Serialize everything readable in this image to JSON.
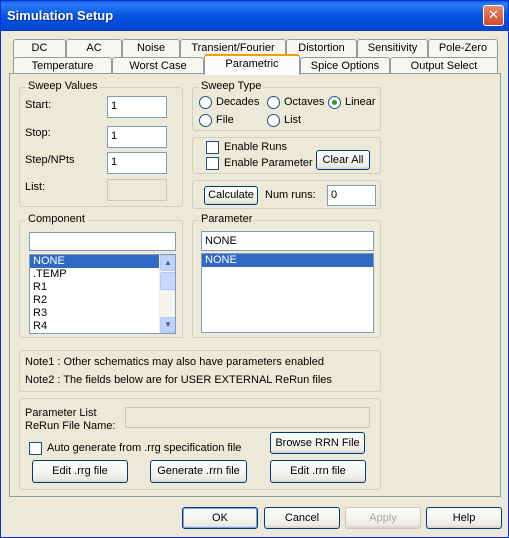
{
  "window": {
    "title": "Simulation Setup",
    "close": "✕"
  },
  "tabs_row1": [
    "DC",
    "AC",
    "Noise",
    "Transient/Fourier",
    "Distortion",
    "Sensitivity",
    "Pole-Zero"
  ],
  "tabs_row2": [
    "Temperature",
    "Worst Case",
    "Parametric",
    "Spice Options",
    "Output Select"
  ],
  "active_tab": "Parametric",
  "sweep_values": {
    "legend": "Sweep Values",
    "start_label": "Start:",
    "start_value": "1",
    "stop_label": "Stop:",
    "stop_value": "1",
    "step_label": "Step/NPts",
    "step_value": "1",
    "list_label": "List:",
    "list_value": ""
  },
  "sweep_type": {
    "legend": "Sweep Type",
    "decades": "Decades",
    "octaves": "Octaves",
    "linear": "Linear",
    "file": "File",
    "list": "List",
    "selected": "Linear"
  },
  "runs": {
    "enable_runs": "Enable Runs",
    "enable_parameter": "Enable Parameter",
    "clear_all": "Clear All"
  },
  "calc": {
    "calculate": "Calculate",
    "num_runs_label": "Num runs:",
    "num_runs_value": "0"
  },
  "component": {
    "legend": "Component",
    "filter_value": "",
    "items": [
      "NONE",
      ".TEMP",
      "R1",
      "R2",
      "R3",
      "R4"
    ],
    "selected": "NONE"
  },
  "parameter": {
    "legend": "Parameter",
    "value": "NONE",
    "items": [
      "NONE"
    ],
    "selected": "NONE"
  },
  "notes": {
    "note1": "Note1 : Other schematics may also have parameters enabled",
    "note2": "Note2 : The fields below are for USER EXTERNAL ReRun files"
  },
  "rerun": {
    "param_list_label": "Parameter List",
    "rerun_file_label": "ReRun File Name:",
    "rerun_file_value": "",
    "auto_generate": "Auto generate from .rrg specification file",
    "browse": "Browse RRN File",
    "edit_rrg": "Edit .rrg file",
    "generate_rrn": "Generate .rrn file",
    "edit_rrn": "Edit .rrn file"
  },
  "footer": {
    "ok": "OK",
    "cancel": "Cancel",
    "apply": "Apply",
    "help": "Help"
  }
}
